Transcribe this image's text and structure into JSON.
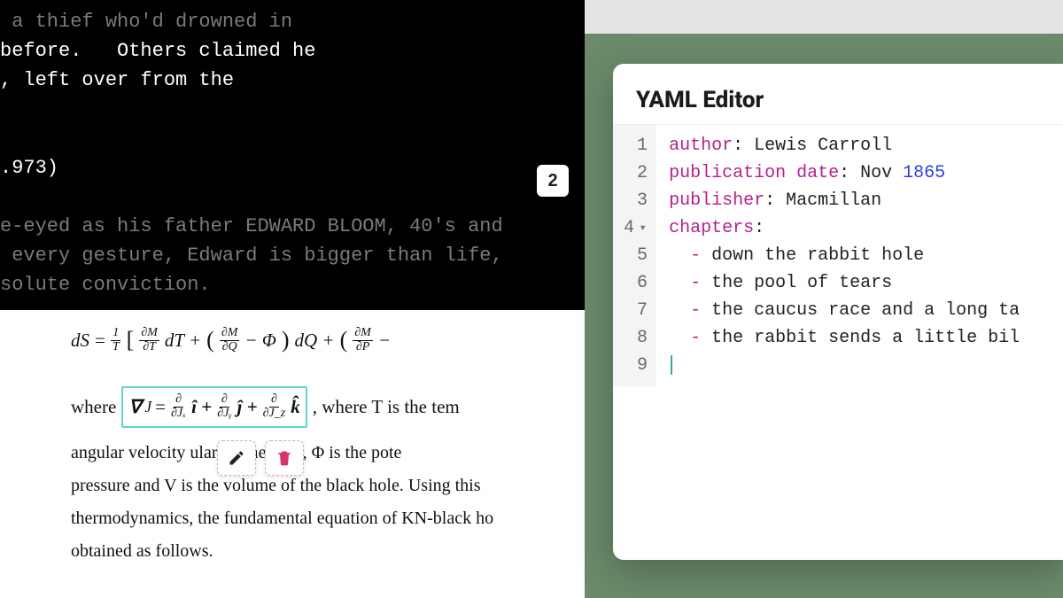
{
  "terminal": {
    "lines": [
      {
        "cls": "dim",
        "text": " a thief who'd drowned in"
      },
      {
        "cls": "bright",
        "text": "before.   Others claimed he"
      },
      {
        "cls": "bright",
        "text": ", left over from the"
      },
      {
        "cls": "",
        "text": " "
      },
      {
        "cls": "",
        "text": " "
      },
      {
        "cls": "bright",
        "text": ".973)"
      },
      {
        "cls": "",
        "text": " "
      },
      {
        "cls": "dim",
        "text": "e-eyed as his father EDWARD BLOOM, 40's and"
      },
      {
        "cls": "dim",
        "text": " every gesture, Edward is bigger than life,"
      },
      {
        "cls": "dim",
        "text": "solute conviction."
      }
    ]
  },
  "badge": {
    "label": "2"
  },
  "mathdoc": {
    "eq1": {
      "lhs": "dS",
      "eq": " = ",
      "f1n": "1",
      "f1d": "T",
      "bracket_open": "[",
      "f2n": "∂M",
      "f2d": "∂T",
      "dT": "dT + ",
      "f3n": "∂M",
      "f3d": "∂Q",
      "minusPhi": " − Φ",
      "dQ": " dQ + ",
      "f4n": "∂M",
      "f4d": "∂P",
      "trail": " −"
    },
    "nabla": {
      "prefix": "where ",
      "lhs": "∇",
      "sub": "J",
      "eq": " = ",
      "d1n": "∂",
      "d1d": "∂Jₓ",
      "i": "î + ",
      "d2n": "∂",
      "d2d": "∂Jᵧ",
      "j": "ĵ + ",
      "d3n": "∂",
      "d3d": "∂J_z",
      "k": "k̂",
      "after": " , where T is the tem"
    },
    "para": [
      "angular velocity              ular momentum, Φ is the pote",
      "pressure and V is the volume of the black hole. Using this ",
      "thermodynamics, the fundamental equation of KN-black ho",
      "obtained as follows."
    ]
  },
  "yaml": {
    "title": "YAML Editor",
    "gutter": [
      "1",
      "2",
      "3",
      "4",
      "5",
      "6",
      "7",
      "8",
      "9"
    ],
    "fold_line": 4,
    "lines": [
      {
        "key": "author",
        "sep": ": ",
        "val": "Lewis Carroll"
      },
      {
        "key": "publication date",
        "sep": ": ",
        "valpre": "Nov ",
        "num": "1865"
      },
      {
        "key": "publisher",
        "sep": ": ",
        "val": "Macmillan"
      },
      {
        "key": "chapters",
        "sep": ":"
      },
      {
        "dash": "  - ",
        "val": "down the rabbit hole"
      },
      {
        "dash": "  - ",
        "val": "the pool of tears"
      },
      {
        "dash": "  - ",
        "val": "the caucus race and a long ta"
      },
      {
        "dash": "  - ",
        "val": "the rabbit sends a little bil"
      },
      {
        "cursor": true
      }
    ]
  }
}
